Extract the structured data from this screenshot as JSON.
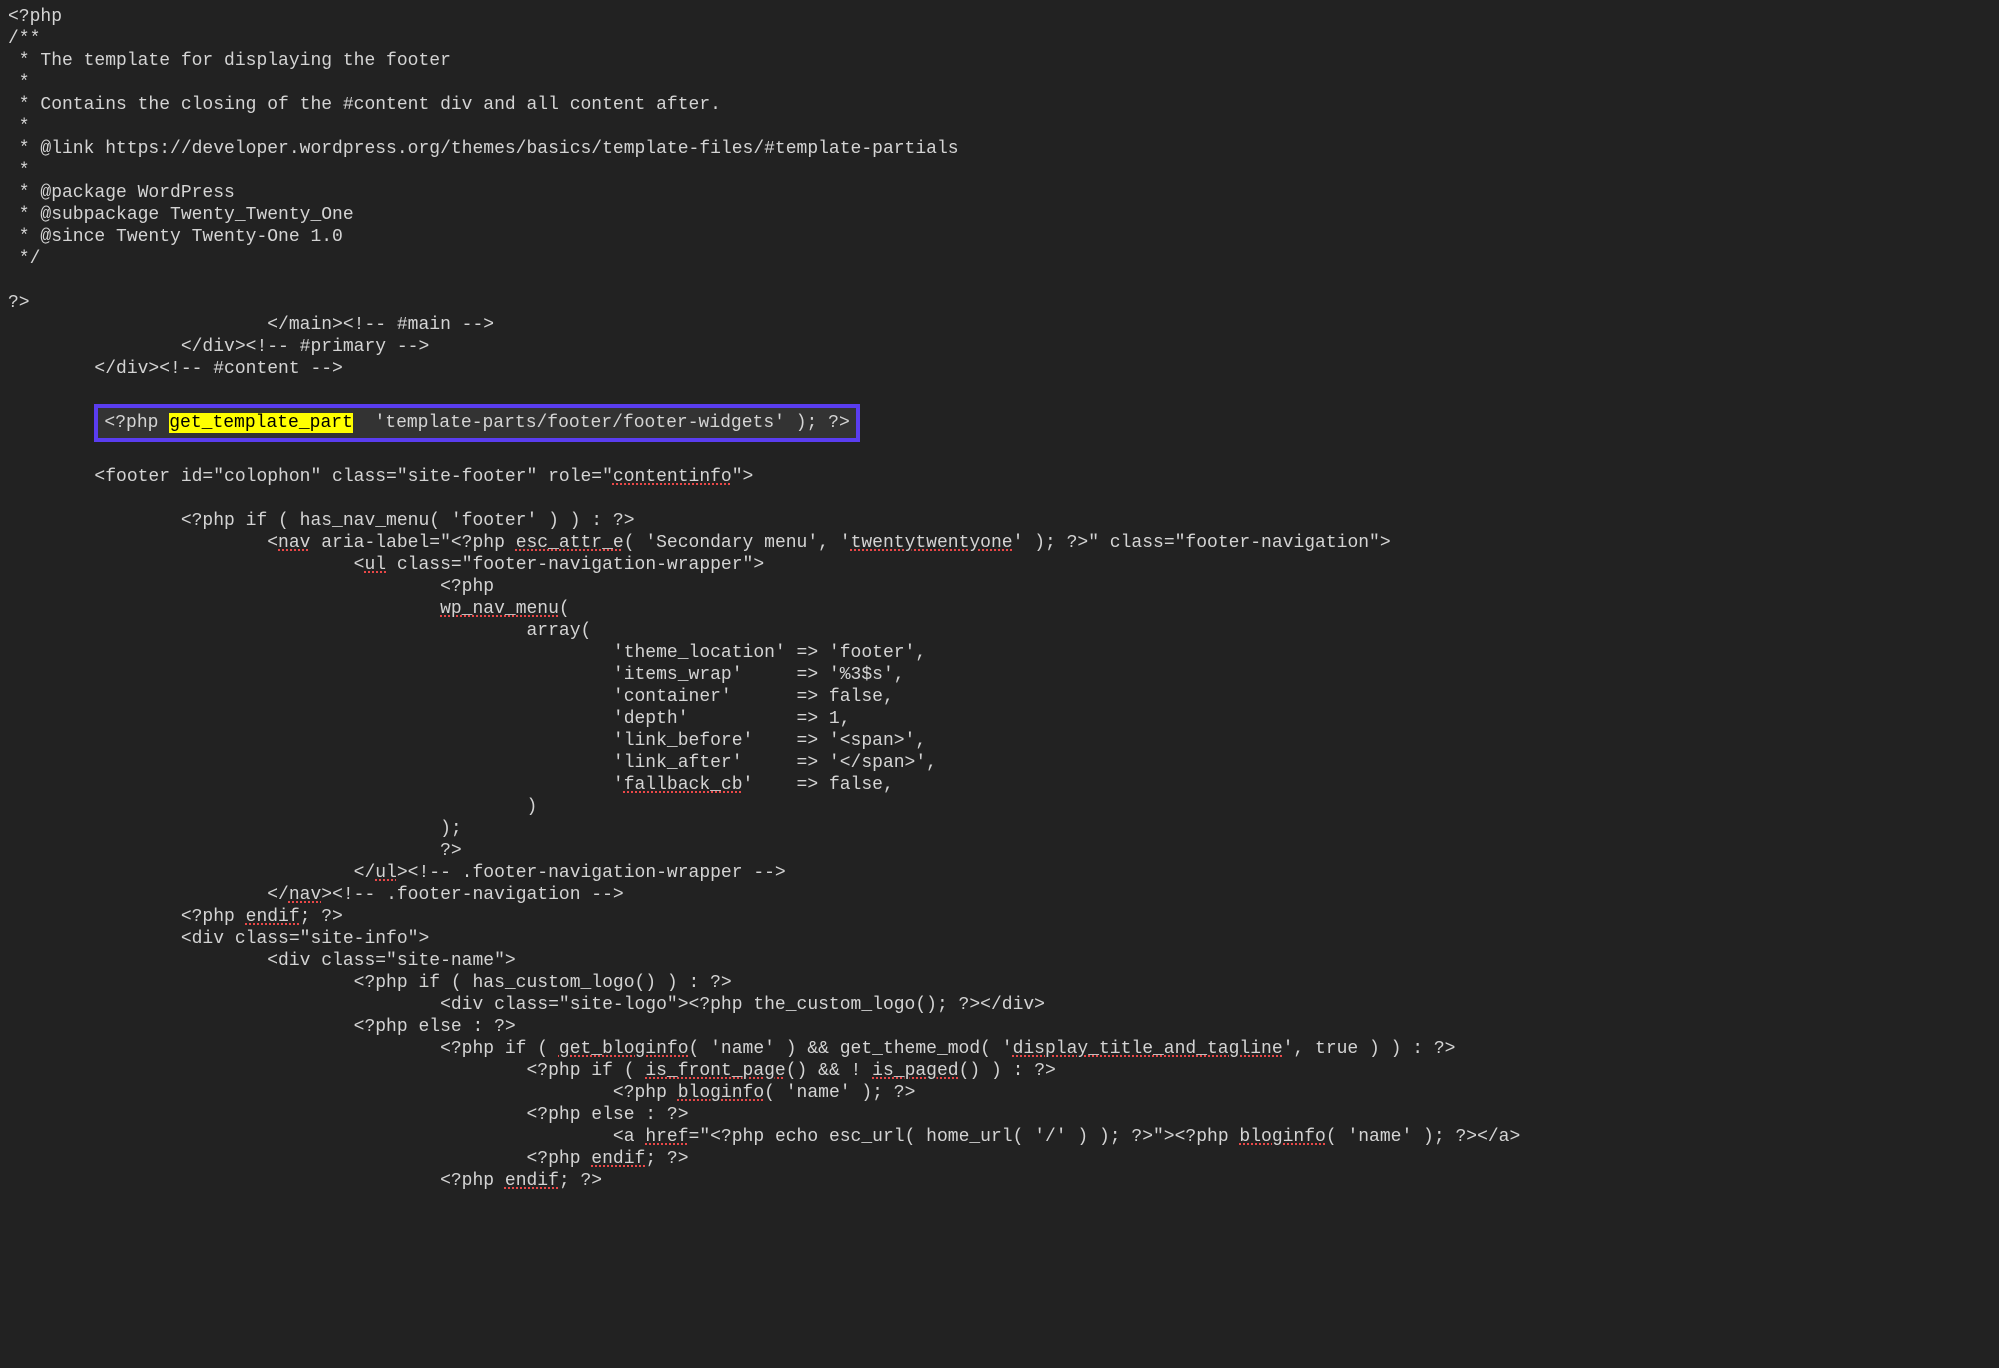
{
  "code": {
    "l01": "<?php",
    "l02": "/**",
    "l03": " * The template for displaying the footer",
    "l04": " *",
    "l05": " * Contains the closing of the #content div and all content after.",
    "l06": " *",
    "l07": " * @link https://developer.wordpress.org/themes/basics/template-files/#template-partials",
    "l08": " *",
    "l09": " * @package WordPress",
    "l10": " * @subpackage Twenty_Twenty_One",
    "l11": " * @since Twenty Twenty-One 1.0",
    "l12": " */",
    "l13": "",
    "l14": "?>",
    "l15": "                        </main><!-- #main -->",
    "l16": "                </div><!-- #primary -->",
    "l17": "        </div><!-- #content -->",
    "l18": "",
    "hl_indent": "        ",
    "hl_prefix": "<?php ",
    "hl_func": "get_template_part",
    "hl_suffix": "  'template-parts/footer/footer-widgets' ); ?>",
    "l20": "",
    "l21a": "        <footer id=\"colophon\" class=\"site-footer\" role=\"",
    "l21b": "contentinfo",
    "l21c": "\">",
    "l22": "",
    "l23a": "                <?php if ( has_nav_menu( 'footer' ) ) : ?>",
    "l24a": "                        <",
    "l24b": "nav",
    "l24c": " aria-label=\"<?php ",
    "l24d": "esc_attr_e",
    "l24e": "( 'Secondary menu', '",
    "l24f": "twentytwentyone",
    "l24g": "' ); ?>\" class=\"footer-navigation\">",
    "l25a": "                                <",
    "l25b": "ul",
    "l25c": " class=\"footer-navigation-wrapper\">",
    "l26": "                                        <?php",
    "l27a": "                                        ",
    "l27b": "wp_nav_menu",
    "l27c": "(",
    "l28": "                                                array(",
    "l29": "                                                        'theme_location' => 'footer',",
    "l30": "                                                        'items_wrap'     => '%3$s',",
    "l31": "                                                        'container'      => false,",
    "l32": "                                                        'depth'          => 1,",
    "l33": "                                                        'link_before'    => '<span>',",
    "l34": "                                                        'link_after'     => '</span>',",
    "l35a": "                                                        '",
    "l35b": "fallback_cb",
    "l35c": "'    => false,",
    "l36": "                                                )",
    "l37": "                                        );",
    "l38": "                                        ?>",
    "l39a": "                                </",
    "l39b": "ul",
    "l39c": "><!-- .footer-navigation-wrapper -->",
    "l40a": "                        </",
    "l40b": "nav",
    "l40c": "><!-- .footer-navigation -->",
    "l41a": "                <?php ",
    "l41b": "endif",
    "l41c": "; ?>",
    "l42": "                <div class=\"site-info\">",
    "l43": "                        <div class=\"site-name\">",
    "l44": "                                <?php if ( has_custom_logo() ) : ?>",
    "l45": "                                        <div class=\"site-logo\"><?php the_custom_logo(); ?></div>",
    "l46": "                                <?php else : ?>",
    "l47a": "                                        <?php if ( ",
    "l47b": "get_bloginfo",
    "l47c": "( 'name' ) && get_theme_mod( '",
    "l47d": "display_title_and_tagline",
    "l47e": "', true ) ) : ?>",
    "l48a": "                                                <?php if ( ",
    "l48b": "is_front_page",
    "l48c": "() && ! ",
    "l48d": "is_paged",
    "l48e": "() ) : ?>",
    "l49a": "                                                        <?php ",
    "l49b": "bloginfo",
    "l49c": "( 'name' ); ?>",
    "l50": "                                                <?php else : ?>",
    "l51a": "                                                        <a ",
    "l51b": "href",
    "l51c": "=\"<?php echo esc_url( home_url( '/' ) ); ?>\"><?php ",
    "l51d": "bloginfo",
    "l51e": "( 'name' ); ?></a>",
    "l52a": "                                                <?php ",
    "l52b": "endif",
    "l52c": "; ?>",
    "l53a": "                                        <?php ",
    "l53b": "endif",
    "l53c": "; ?>"
  }
}
